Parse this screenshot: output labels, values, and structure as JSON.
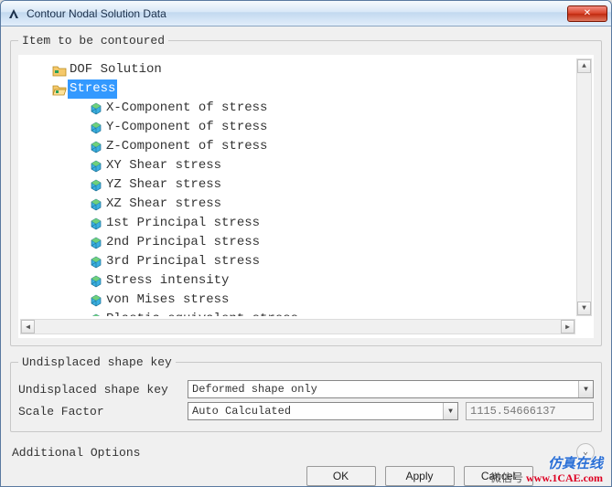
{
  "window": {
    "title": "Contour Nodal Solution Data",
    "close_symbol": "✕"
  },
  "contour_group": {
    "legend": "Item to be contoured"
  },
  "tree": {
    "items": [
      {
        "indent": 0,
        "icon": "folder-dof",
        "label": "DOF Solution",
        "selected": false
      },
      {
        "indent": 0,
        "icon": "folder-open",
        "label": "Stress",
        "selected": true
      },
      {
        "indent": 1,
        "icon": "result-cube",
        "label": "X-Component of stress",
        "selected": false
      },
      {
        "indent": 1,
        "icon": "result-cube",
        "label": "Y-Component of stress",
        "selected": false
      },
      {
        "indent": 1,
        "icon": "result-cube",
        "label": "Z-Component of stress",
        "selected": false
      },
      {
        "indent": 1,
        "icon": "result-cube",
        "label": "XY Shear stress",
        "selected": false
      },
      {
        "indent": 1,
        "icon": "result-cube",
        "label": "YZ Shear stress",
        "selected": false
      },
      {
        "indent": 1,
        "icon": "result-cube",
        "label": "XZ Shear stress",
        "selected": false
      },
      {
        "indent": 1,
        "icon": "result-cube",
        "label": "1st Principal stress",
        "selected": false
      },
      {
        "indent": 1,
        "icon": "result-cube",
        "label": "2nd Principal stress",
        "selected": false
      },
      {
        "indent": 1,
        "icon": "result-cube",
        "label": "3rd Principal stress",
        "selected": false
      },
      {
        "indent": 1,
        "icon": "result-cube",
        "label": "Stress intensity",
        "selected": false
      },
      {
        "indent": 1,
        "icon": "result-cube",
        "label": "von Mises stress",
        "selected": false
      },
      {
        "indent": 1,
        "icon": "result-cube",
        "label": "Plastic equivalent stress",
        "selected": false
      }
    ]
  },
  "shape_group": {
    "legend": "Undisplaced shape key",
    "row1_label": "Undisplaced shape key",
    "row1_value": "Deformed shape only",
    "row2_label": "Scale Factor",
    "row2_value": "Auto Calculated",
    "scale_number": "1115.54666137"
  },
  "additional": {
    "label": "Additional Options"
  },
  "buttons": {
    "ok": "OK",
    "apply": "Apply",
    "cancel": "Cancel"
  },
  "watermark": {
    "line1": "仿真在线",
    "line2a": "微信号",
    "line2b": "www.1CAE.com"
  },
  "icons": {
    "app_svg": "A"
  }
}
